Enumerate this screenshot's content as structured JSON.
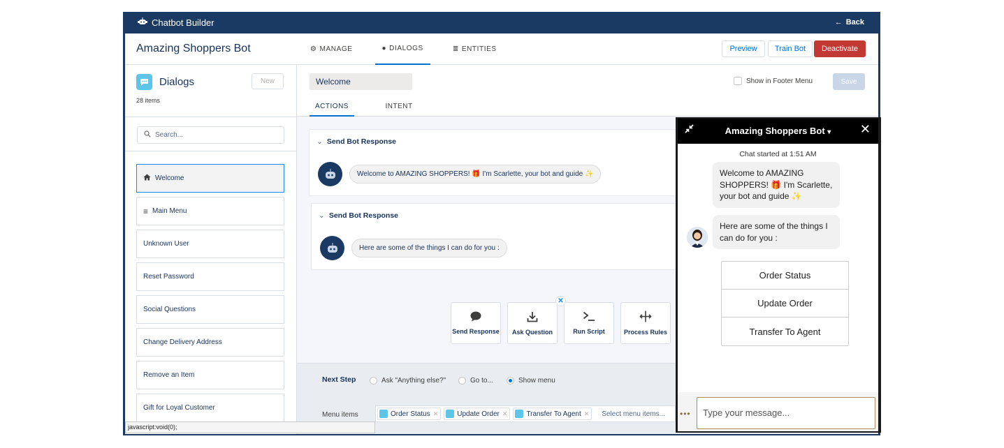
{
  "topbar": {
    "brand": "Chatbot Builder",
    "back": "Back"
  },
  "header": {
    "bot_name": "Amazing Shoppers Bot",
    "tabs": [
      {
        "label": "MANAGE",
        "icon": "gear-icon"
      },
      {
        "label": "DIALOGS",
        "icon": "chat-icon"
      },
      {
        "label": "ENTITIES",
        "icon": "list-icon"
      }
    ],
    "preview": "Preview",
    "train": "Train Bot",
    "deactivate": "Deactivate"
  },
  "sidebar": {
    "title": "Dialogs",
    "count": "28 items",
    "new_label": "New",
    "search_placeholder": "Search...",
    "items": [
      {
        "label": "Welcome",
        "icon": "home-icon"
      },
      {
        "label": "Main Menu",
        "icon": "menu-icon"
      },
      {
        "label": "Unknown User"
      },
      {
        "label": "Reset Password"
      },
      {
        "label": "Social Questions"
      },
      {
        "label": "Change Delivery Address"
      },
      {
        "label": "Remove an Item"
      },
      {
        "label": "Gift for Loyal Customer"
      }
    ]
  },
  "editor": {
    "dialog_name": "Welcome",
    "footer_menu": "Show in Footer Menu",
    "save": "Save",
    "subtabs": [
      "ACTIONS",
      "INTENT"
    ],
    "cards": [
      {
        "title": "Send Bot Response",
        "message": "Welcome to AMAZING SHOPPERS! 🎁 I'm Scarlette, your bot and guide ✨"
      },
      {
        "title": "Send Bot Response",
        "message": "Here are some of the things I can do for you :"
      }
    ],
    "actions": [
      "Send Response",
      "Ask Question",
      "Run Script",
      "Process Rules"
    ],
    "next_step": {
      "title": "Next Step",
      "options": [
        "Ask \"Anything else?\"",
        "Go to...",
        "Show menu"
      ],
      "selected": "Show menu",
      "menu_label": "Menu items",
      "menu_items": [
        "Order Status",
        "Update Order",
        "Transfer To Agent"
      ],
      "menu_placeholder": "Select menu items..."
    }
  },
  "statusbar": "javascript:void(0);",
  "chat": {
    "title": "Amazing Shoppers Bot",
    "started": "Chat started at 1:51 AM",
    "msg1": "Welcome to AMAZING SHOPPERS! 🎁 I'm Scarlette, your bot and guide ✨",
    "msg2": "Here are some of the things I can do for you :",
    "menu": [
      "Order Status",
      "Update Order",
      "Transfer To Agent"
    ],
    "input_placeholder": "Type your message..."
  },
  "colors": {
    "navy": "#1b3a63",
    "accent": "#0070d2",
    "danger": "#c23934",
    "dialog_icon": "#5ec5e9"
  }
}
